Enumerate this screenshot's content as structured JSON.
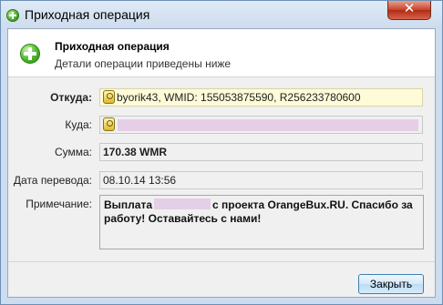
{
  "window": {
    "title": "Приходная операция",
    "close_glyph": "✕"
  },
  "header": {
    "title": "Приходная операция",
    "subtitle": "Детали операции приведены ниже"
  },
  "fields": {
    "from_label": "Откуда:",
    "from_value": "byorik43, WMID: 155053875590, R256233780600",
    "to_label": "Куда:",
    "to_value": "",
    "amount_label": "Сумма:",
    "amount_value": "170.38 WMR",
    "date_label": "Дата перевода:",
    "date_value": "08.10.14 13:56",
    "note_label": "Примечание:",
    "note_before": "Выплата",
    "note_after": "с проекта OrangeBux.RU. Спасибо за работу! Оставайтесь с нами!"
  },
  "buttons": {
    "close_label": "Закрыть"
  },
  "colors": {
    "accent_green": "#3a9b1e",
    "redaction": "#e4cfe7",
    "highlight_field": "#fdfbd8"
  }
}
